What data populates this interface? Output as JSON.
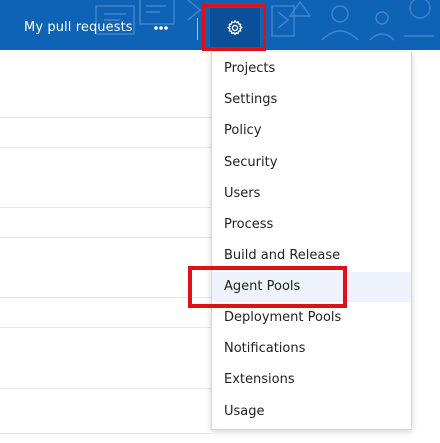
{
  "header": {
    "nav_link_label": "My pull requests",
    "more_icon": "ellipsis-icon",
    "settings_icon": "gear-icon",
    "bar_color": "#0f63b7",
    "selected_button_color": "#0b4f99"
  },
  "settings_menu": {
    "items": [
      {
        "label": "Projects"
      },
      {
        "label": "Settings"
      },
      {
        "label": "Policy"
      },
      {
        "label": "Security"
      },
      {
        "label": "Users"
      },
      {
        "label": "Process"
      },
      {
        "label": "Build and Release"
      },
      {
        "label": "Agent Pools"
      },
      {
        "label": "Deployment Pools"
      },
      {
        "label": "Notifications"
      },
      {
        "label": "Extensions"
      },
      {
        "label": "Usage"
      }
    ],
    "highlighted_item": "Agent Pools",
    "highlight_color": "#e10f16"
  }
}
